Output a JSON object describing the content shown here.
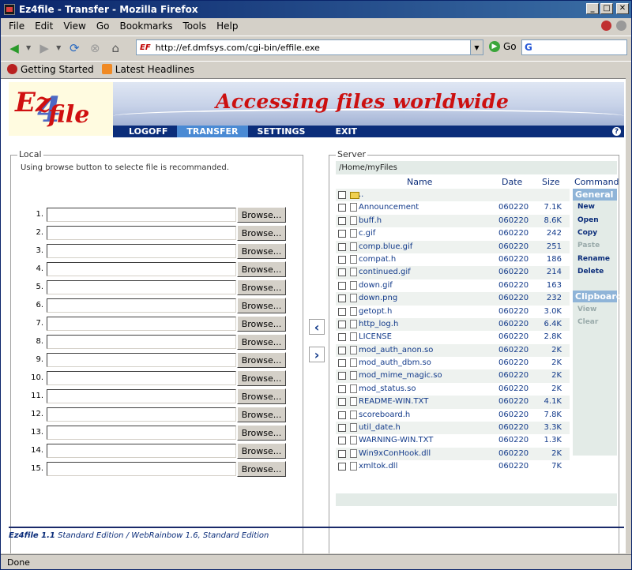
{
  "window": {
    "title": "Ez4file - Transfer - Mozilla Firefox"
  },
  "menu": [
    "File",
    "Edit",
    "View",
    "Go",
    "Bookmarks",
    "Tools",
    "Help"
  ],
  "toolbar": {
    "url": "http://ef.dmfsys.com/cgi-bin/effile.exe",
    "url_badge": "EF",
    "go_label": "Go",
    "search_badge": "G"
  },
  "bookmarks": [
    "Getting Started",
    "Latest Headlines"
  ],
  "banner": {
    "logo_e": "Ez",
    "logo_4": "4",
    "logo_file": "file",
    "slogan": "Accessing files worldwide",
    "nav": [
      "LOGOFF",
      "TRANSFER",
      "SETTINGS",
      "EXIT"
    ],
    "active_nav": "TRANSFER",
    "help": "?"
  },
  "local": {
    "title": "Local",
    "note": "Using browse button to selecte file is recommanded.",
    "browse_label": "Browse...",
    "rows": [
      "1.",
      "2.",
      "3.",
      "4.",
      "5.",
      "6.",
      "7.",
      "8.",
      "9.",
      "10.",
      "11.",
      "12.",
      "13.",
      "14.",
      "15."
    ]
  },
  "transfer": {
    "left": "‹",
    "right": "›"
  },
  "server": {
    "title": "Server",
    "path": "/Home/myFiles",
    "columns": {
      "name": "Name",
      "date": "Date",
      "size": "Size",
      "command": "Command"
    },
    "files": [
      {
        "name": "..",
        "date": "",
        "size": "",
        "type": "folder"
      },
      {
        "name": "Announcement",
        "date": "060220",
        "size": "7.1K",
        "type": "file"
      },
      {
        "name": "buff.h",
        "date": "060220",
        "size": "8.6K",
        "type": "file"
      },
      {
        "name": "c.gif",
        "date": "060220",
        "size": "242",
        "type": "file"
      },
      {
        "name": "comp.blue.gif",
        "date": "060220",
        "size": "251",
        "type": "file"
      },
      {
        "name": "compat.h",
        "date": "060220",
        "size": "186",
        "type": "file"
      },
      {
        "name": "continued.gif",
        "date": "060220",
        "size": "214",
        "type": "file"
      },
      {
        "name": "down.gif",
        "date": "060220",
        "size": "163",
        "type": "file"
      },
      {
        "name": "down.png",
        "date": "060220",
        "size": "232",
        "type": "file"
      },
      {
        "name": "getopt.h",
        "date": "060220",
        "size": "3.0K",
        "type": "file"
      },
      {
        "name": "http_log.h",
        "date": "060220",
        "size": "6.4K",
        "type": "file"
      },
      {
        "name": "LICENSE",
        "date": "060220",
        "size": "2.8K",
        "type": "file"
      },
      {
        "name": "mod_auth_anon.so",
        "date": "060220",
        "size": "2K",
        "type": "file"
      },
      {
        "name": "mod_auth_dbm.so",
        "date": "060220",
        "size": "2K",
        "type": "file"
      },
      {
        "name": "mod_mime_magic.so",
        "date": "060220",
        "size": "2K",
        "type": "file"
      },
      {
        "name": "mod_status.so",
        "date": "060220",
        "size": "2K",
        "type": "file"
      },
      {
        "name": "README-WIN.TXT",
        "date": "060220",
        "size": "4.1K",
        "type": "file"
      },
      {
        "name": "scoreboard.h",
        "date": "060220",
        "size": "7.8K",
        "type": "file"
      },
      {
        "name": "util_date.h",
        "date": "060220",
        "size": "3.3K",
        "type": "file"
      },
      {
        "name": "WARNING-WIN.TXT",
        "date": "060220",
        "size": "1.3K",
        "type": "file"
      },
      {
        "name": "Win9xConHook.dll",
        "date": "060220",
        "size": "2K",
        "type": "file"
      },
      {
        "name": "xmltok.dll",
        "date": "060220",
        "size": "7K",
        "type": "file"
      }
    ],
    "command_groups": {
      "general": {
        "title": "General",
        "items": [
          "New",
          "Open",
          "Copy",
          "Paste",
          "Rename",
          "Delete"
        ],
        "disabled": [
          "Paste"
        ]
      },
      "clipboard": {
        "title": "Clipboard",
        "items": [
          "View",
          "Clear"
        ],
        "disabled": [
          "View",
          "Clear"
        ]
      }
    }
  },
  "footer": {
    "product": "Ez4file 1.1",
    "edition": " Standard Edition / WebRainbow 1.6, Standard Edition"
  },
  "status": "Done",
  "colors": {
    "title_bar": "#0a246a",
    "nav_strip": "#0b2d7a",
    "active_tab": "#4a8ad4",
    "link": "#123a8a",
    "logo_red": "#d01010"
  }
}
